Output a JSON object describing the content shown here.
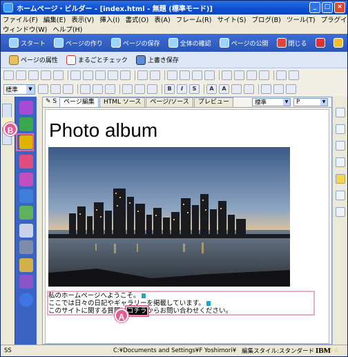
{
  "window": {
    "title": "ホームページ・ビルダー - [index.html - 無題 (標準モード)]"
  },
  "menu": {
    "row1": [
      "ファイル(F)",
      "編集(E)",
      "表示(V)",
      "挿入(I)",
      "書式(O)",
      "表(A)",
      "フレーム(R)",
      "サイト(S)",
      "ブログ(B)",
      "ツール(T)",
      "プラグイン(P)"
    ],
    "row2": [
      "ウィンドウ(W)",
      "ヘルプ(H)"
    ]
  },
  "task_bar": {
    "items": [
      "スタート",
      "ページの作り",
      "ページの保存",
      "全体の確認",
      "ページの公開",
      "閉じる"
    ]
  },
  "sub_bar": {
    "items": [
      "ページの属性",
      "まるごとチェック",
      "上書き保存"
    ]
  },
  "toolbar2": {
    "style_combo": "標準"
  },
  "editor": {
    "tabs": [
      "ページ編集",
      "HTML ソース",
      "ページ/ソース",
      "プレビュー"
    ],
    "active_tab": "ページ編集",
    "style_combo": "標準",
    "tag_combo": "P"
  },
  "page": {
    "heading": "Photo album",
    "line1": "私のホームページへようこそ。",
    "line2": "ここでは日々の日記やギャラリーを掲載しています。",
    "line3_before": "このサイトに関する質問は",
    "line3_link": "コチラ",
    "line3_after": "からお問い合わせください。"
  },
  "callouts": {
    "a": "A",
    "b": "B"
  },
  "status": {
    "mode": "SS",
    "path": "C:¥Documents and Settings¥F Yoshimori¥",
    "style": "編集スタイル:スタンダード",
    "brand": "IBM"
  },
  "colors": {
    "accent": "#e65a8f",
    "title_blue": "#0a4fd0",
    "bar_blue": "#2a54b8"
  }
}
